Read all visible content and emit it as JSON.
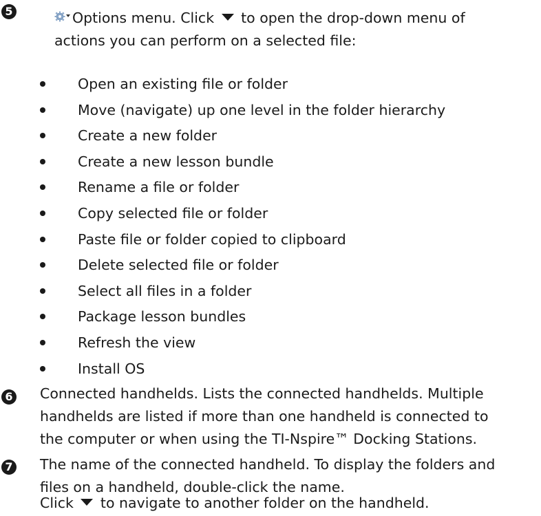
{
  "item5": {
    "number": "5",
    "intro_prefix": "Options menu. Click",
    "intro_suffix": "to open the drop-down menu of",
    "intro_line2": "actions you can perform on a selected file:",
    "bullets": [
      "Open an existing file or folder",
      "Move (navigate) up one level in the folder hierarchy",
      "Create a new folder",
      "Create a new lesson bundle",
      "Rename a file or folder",
      "Copy selected file or folder",
      "Paste file or folder copied to clipboard",
      "Delete selected file or folder",
      "Select all files in a folder",
      "Package lesson bundles",
      "Refresh the view",
      "Install OS"
    ]
  },
  "item6": {
    "number": "6",
    "lines": [
      "Connected handhelds. Lists the connected handhelds. Multiple",
      "handhelds are listed if more than one handheld is connected to",
      "the computer or when using the TI-Nspire™ Docking Stations."
    ]
  },
  "item7": {
    "number": "7",
    "lines": [
      "The name of the connected handheld. To display the folders and",
      "files on a handheld, double-click the name."
    ],
    "click_prefix": "Click",
    "click_suffix": "to navigate to another folder on the handheld."
  },
  "icons": {
    "options": "gear-icon",
    "dropdown": "caret-down-icon"
  }
}
